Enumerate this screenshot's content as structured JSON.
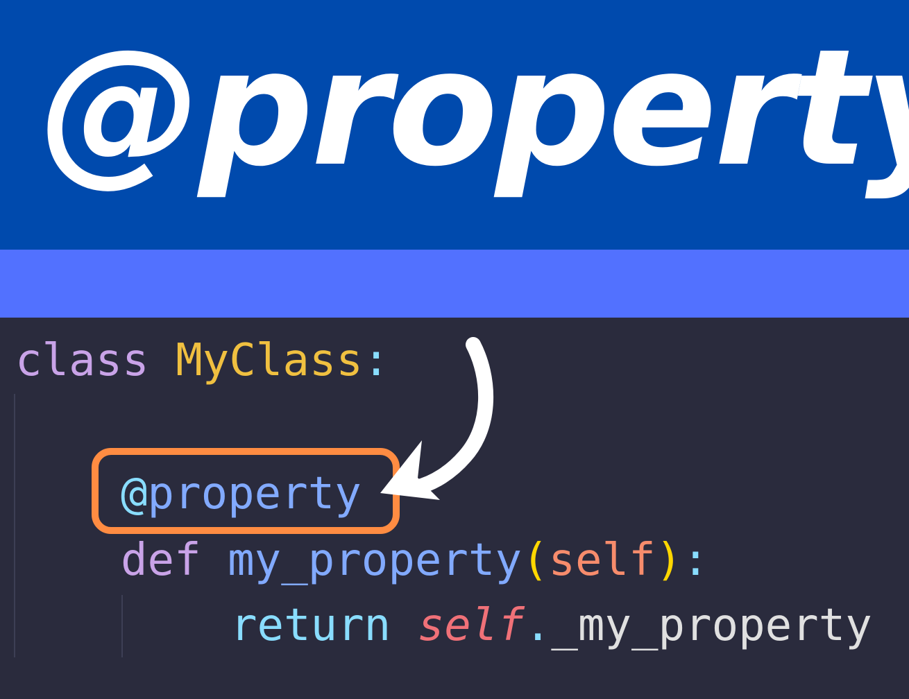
{
  "banner": {
    "title": "@property"
  },
  "code": {
    "line1": {
      "keyword": "class",
      "name": "MyClass",
      "colon": ":"
    },
    "line2": {
      "at": "@",
      "decorator": "property"
    },
    "line3": {
      "keyword": "def",
      "name": "my_property",
      "open_paren": "(",
      "param": "self",
      "close_paren": ")",
      "colon": ":"
    },
    "line4": {
      "keyword": "return",
      "self": "self",
      "dot": ".",
      "attr": "_my_property"
    }
  },
  "colors": {
    "banner_bg": "#004aad",
    "stripe_bg": "#5271ff",
    "editor_bg": "#2a2b3d",
    "highlight": "#ff8c42",
    "arrow": "#ffffff"
  },
  "icons": [
    "curved-arrow-icon"
  ]
}
